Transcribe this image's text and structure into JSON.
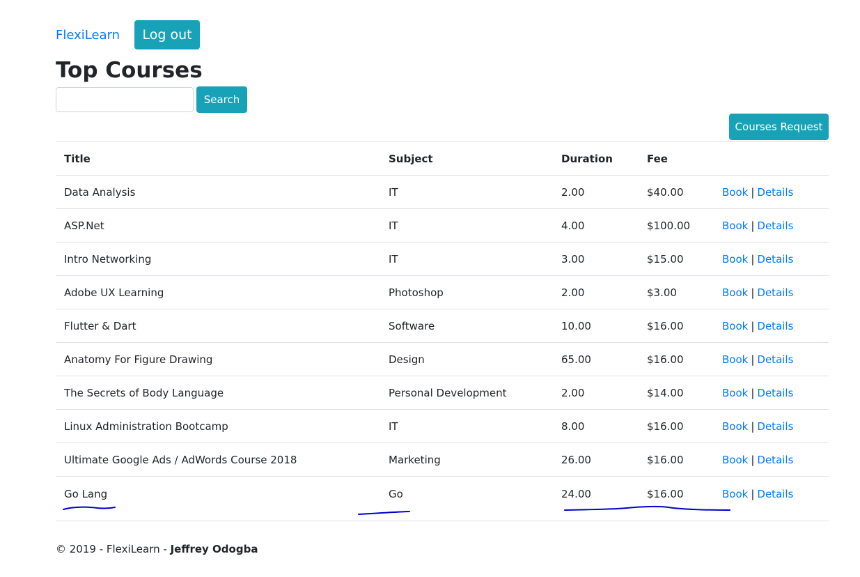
{
  "nav": {
    "brand": "FlexiLearn",
    "logout_label": "Log out"
  },
  "page_title": "Top Courses",
  "search": {
    "value": "",
    "button_label": "Search"
  },
  "courses_request_label": "Courses Request",
  "table": {
    "headers": [
      "Title",
      "Subject",
      "Duration",
      "Fee",
      ""
    ],
    "rows": [
      {
        "title": "Data Analysis",
        "subject": "IT",
        "duration": "2.00",
        "fee": "$40.00"
      },
      {
        "title": "ASP.Net",
        "subject": "IT",
        "duration": "4.00",
        "fee": "$100.00"
      },
      {
        "title": "Intro Networking",
        "subject": "IT",
        "duration": "3.00",
        "fee": "$15.00"
      },
      {
        "title": "Adobe UX Learning",
        "subject": "Photoshop",
        "duration": "2.00",
        "fee": "$3.00"
      },
      {
        "title": "Flutter & Dart",
        "subject": "Software",
        "duration": "10.00",
        "fee": "$16.00"
      },
      {
        "title": "Anatomy For Figure Drawing",
        "subject": "Design",
        "duration": "65.00",
        "fee": "$16.00"
      },
      {
        "title": "The Secrets of Body Language",
        "subject": "Personal Development",
        "duration": "2.00",
        "fee": "$14.00"
      },
      {
        "title": "Linux Administration Bootcamp",
        "subject": "IT",
        "duration": "8.00",
        "fee": "$16.00"
      },
      {
        "title": "Ultimate Google Ads / AdWords Course 2018",
        "subject": "Marketing",
        "duration": "26.00",
        "fee": "$16.00"
      },
      {
        "title": "Go Lang",
        "subject": "Go",
        "duration": "24.00",
        "fee": "$16.00"
      }
    ],
    "book_label": "Book",
    "separator": "|",
    "details_label": "Details"
  },
  "footer": {
    "prefix": "© 2019 - FlexiLearn - ",
    "author": "Jeffrey Odogba"
  },
  "colors": {
    "accent": "#17a2b8",
    "link": "#007bff",
    "annotation_ink": "#0000cc"
  }
}
